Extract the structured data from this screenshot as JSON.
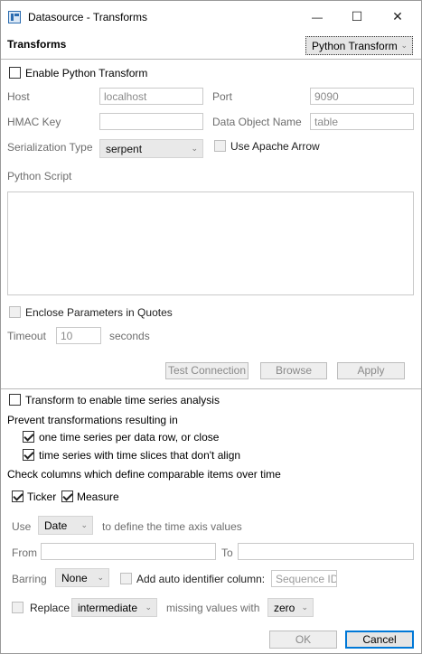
{
  "window": {
    "title": "Datasource - Transforms",
    "icon": "datasource-app-icon",
    "controls": {
      "minimize": "—",
      "maximize": "☐",
      "close": "✕"
    }
  },
  "header": {
    "title": "Transforms",
    "transform_type": "Python Transform"
  },
  "python": {
    "enable_label": "Enable Python Transform",
    "enable_checked": false,
    "host_label": "Host",
    "host_value": "localhost",
    "port_label": "Port",
    "port_value": "9090",
    "hmac_label": "HMAC Key",
    "hmac_value": "",
    "data_object_label": "Data Object Name",
    "data_object_value": "table",
    "serialization_label": "Serialization Type",
    "serialization_value": "serpent",
    "apache_arrow_label": "Use Apache Arrow",
    "script_label": "Python Script",
    "script_value": "",
    "enclose_label": "Enclose Parameters in Quotes",
    "timeout_label": "Timeout",
    "timeout_value": "10",
    "timeout_unit": "seconds",
    "test_connection": "Test Connection",
    "browse": "Browse",
    "apply": "Apply"
  },
  "timeseries": {
    "enable_label": "Transform to enable time series analysis",
    "prevent_label": "Prevent transformations resulting in",
    "opt_one_series": "one time series per data row, or close",
    "opt_slices": "time series with time slices that don't align",
    "check_columns_label": "Check columns which define comparable items over time",
    "col_ticker": "Ticker",
    "col_measure": "Measure",
    "use_label": "Use",
    "use_value": "Date",
    "time_axis_label": "to define the time axis values",
    "from_label": "From",
    "from_value": "",
    "to_label": "To",
    "to_value": "",
    "barring_label": "Barring",
    "barring_value": "None",
    "auto_id_label": "Add auto identifier column:",
    "auto_id_placeholder": "Sequence ID",
    "replace_label": "Replace",
    "replace_value": "intermediate",
    "missing_label": "missing values with",
    "missing_value": "zero"
  },
  "footer": {
    "ok": "OK",
    "cancel": "Cancel"
  }
}
